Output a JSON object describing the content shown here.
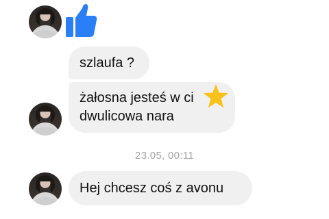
{
  "conversation": {
    "reaction_icon": "thumbs-up-icon",
    "messages": [
      {
        "text": "szlaufa ?"
      },
      {
        "lines": [
          "żałosna jesteś w ci",
          "dwulicowa nara"
        ],
        "overlay_icon": "star-icon"
      },
      {
        "text": "Hej chcesz coś z avonu"
      }
    ],
    "timestamp": "23.05, 00:11"
  },
  "colors": {
    "bubble_bg": "#f0f0f0",
    "like_blue": "#2a7ff6",
    "star_yellow": "#f7c31a",
    "timestamp_gray": "#a3a3a3"
  }
}
